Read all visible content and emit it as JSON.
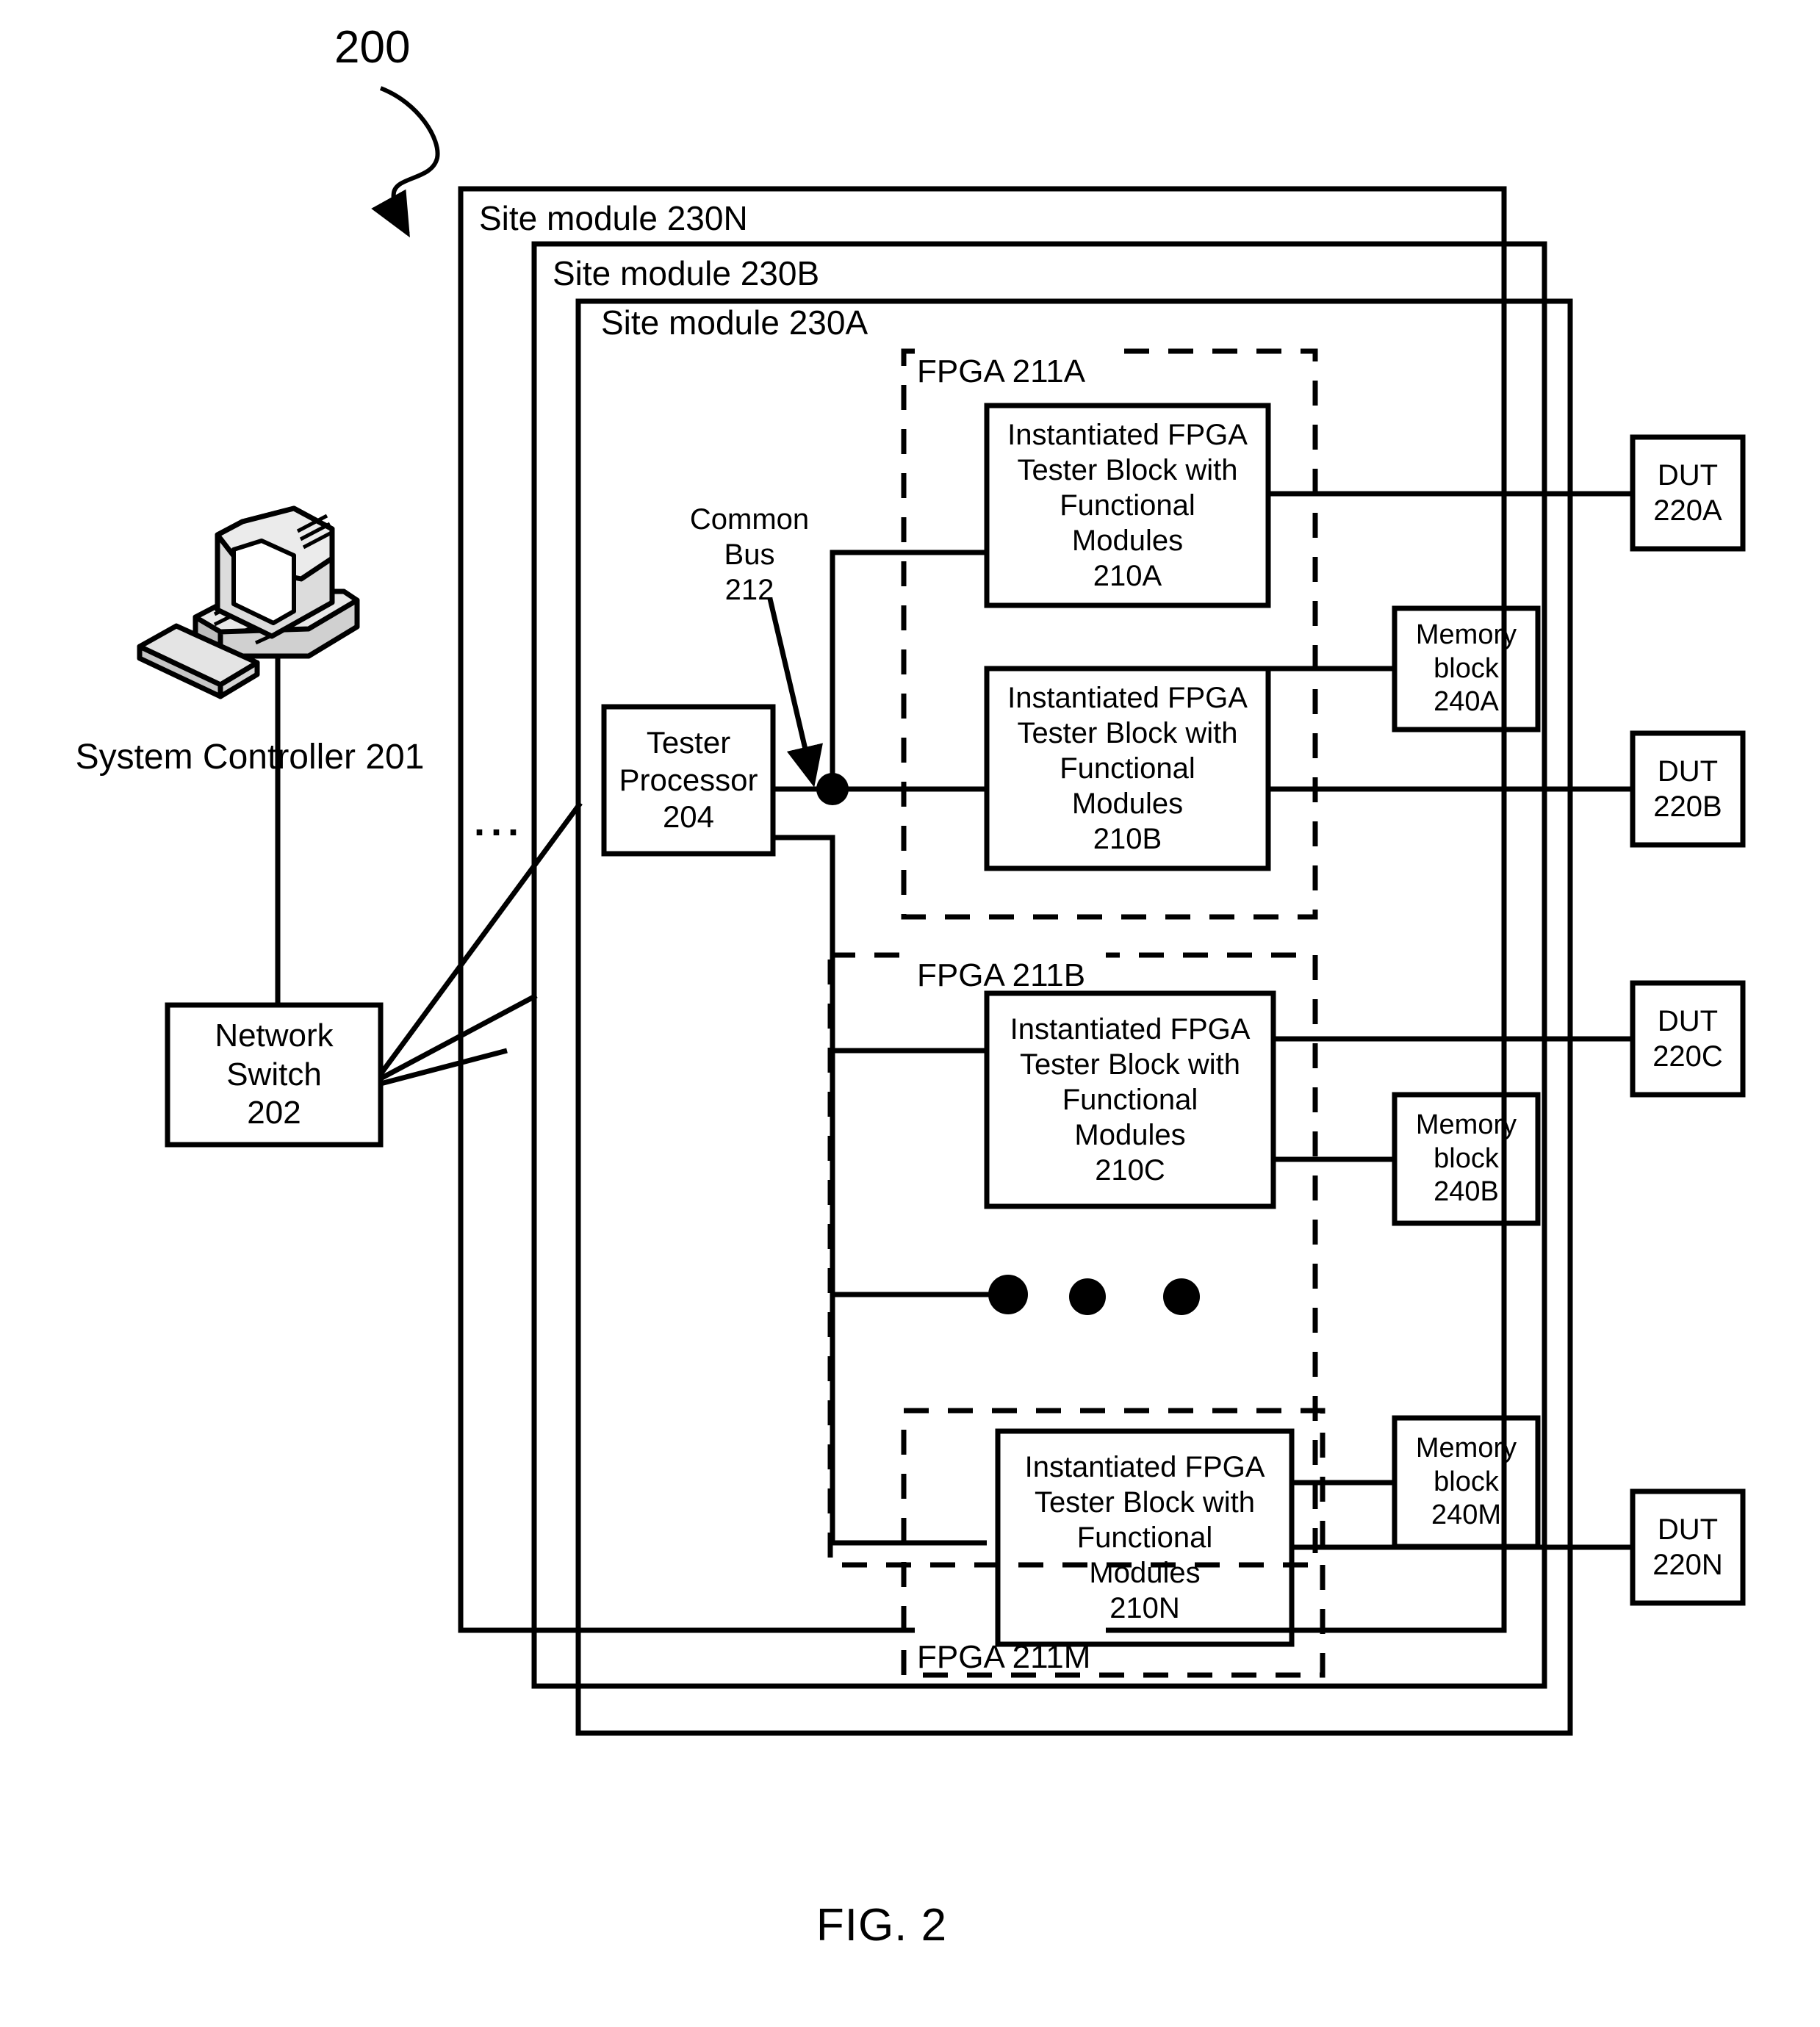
{
  "figure": {
    "number_callout": "200",
    "caption": "FIG. 2"
  },
  "system_controller": {
    "label": "System Controller 201",
    "icon": "desktop-computer-icon"
  },
  "network_switch": {
    "lines": [
      "Network",
      "Switch",
      "202"
    ]
  },
  "site_modules": [
    {
      "id": "230N",
      "label": "Site module 230N"
    },
    {
      "id": "230B",
      "label": "Site module 230B"
    },
    {
      "id": "230A",
      "label": "Site module 230A"
    }
  ],
  "ellipsis_site": "...",
  "tester_processor": {
    "lines": [
      "Tester",
      "Processor",
      "204"
    ]
  },
  "common_bus": {
    "lines": [
      "Common",
      "Bus",
      "212"
    ]
  },
  "fpgas": [
    {
      "id": "211A",
      "label": "FPGA 211A"
    },
    {
      "id": "211B",
      "label": "FPGA 211B"
    },
    {
      "id": "211M",
      "label": "FPGA 211M"
    }
  ],
  "tester_blocks": [
    {
      "id": "210A",
      "lines": [
        "Instantiated FPGA",
        "Tester Block with",
        "Functional",
        "Modules",
        "210A"
      ]
    },
    {
      "id": "210B",
      "lines": [
        "Instantiated FPGA",
        "Tester Block with",
        "Functional",
        "Modules",
        "210B"
      ]
    },
    {
      "id": "210C",
      "lines": [
        "Instantiated FPGA",
        "Tester Block with",
        "Functional",
        "Modules",
        "210C"
      ]
    },
    {
      "id": "210N",
      "lines": [
        "Instantiated FPGA",
        "Tester Block with",
        "Functional",
        "Modules",
        "210N"
      ]
    }
  ],
  "memory_blocks": [
    {
      "id": "240A",
      "lines": [
        "Memory",
        "block",
        "240A"
      ]
    },
    {
      "id": "240B",
      "lines": [
        "Memory",
        "block",
        "240B"
      ]
    },
    {
      "id": "240M",
      "lines": [
        "Memory",
        "block",
        "240M"
      ]
    }
  ],
  "duts": [
    {
      "id": "220A",
      "lines": [
        "DUT",
        "220A"
      ]
    },
    {
      "id": "220B",
      "lines": [
        "DUT",
        "220B"
      ]
    },
    {
      "id": "220C",
      "lines": [
        "DUT",
        "220C"
      ]
    },
    {
      "id": "220N",
      "lines": [
        "DUT",
        "220N"
      ]
    }
  ],
  "vertical_ellipsis_dots": 3,
  "colors": {
    "stroke": "#000000",
    "background": "#ffffff"
  }
}
